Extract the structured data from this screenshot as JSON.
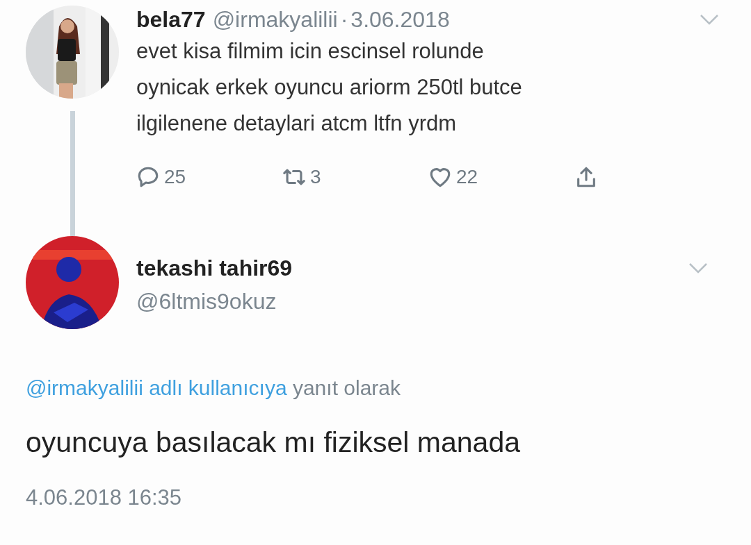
{
  "parent_tweet": {
    "avatar": {
      "kind": "picture"
    },
    "name": "bela77",
    "handle": "@irmakyalilii",
    "separator": "·",
    "date": "3.06.2018",
    "text_lines": [
      "evet kisa filmim icin escinsel rolunde",
      "oynicak erkek oyuncu ariorm 250tl butce",
      "ilgilenene detaylari atcm ltfn yrdm"
    ],
    "actions": [
      {
        "kind": "reply",
        "count": "25"
      },
      {
        "kind": "retweet",
        "count": "3"
      },
      {
        "kind": "like",
        "count": "22"
      },
      {
        "kind": "share"
      }
    ]
  },
  "reply_tweet": {
    "avatar": {
      "kind": "picture"
    },
    "name": "tekashi tahir69",
    "handle": "@6ltmis9okuz",
    "reply_to": {
      "mention": "@irmakyalilii adlı kullanıcıya",
      "suffix": "yanıt olarak"
    },
    "text": "oyuncuya basılacak mı fiziksel manada",
    "timestamp": "4.06.2018 16:35"
  }
}
